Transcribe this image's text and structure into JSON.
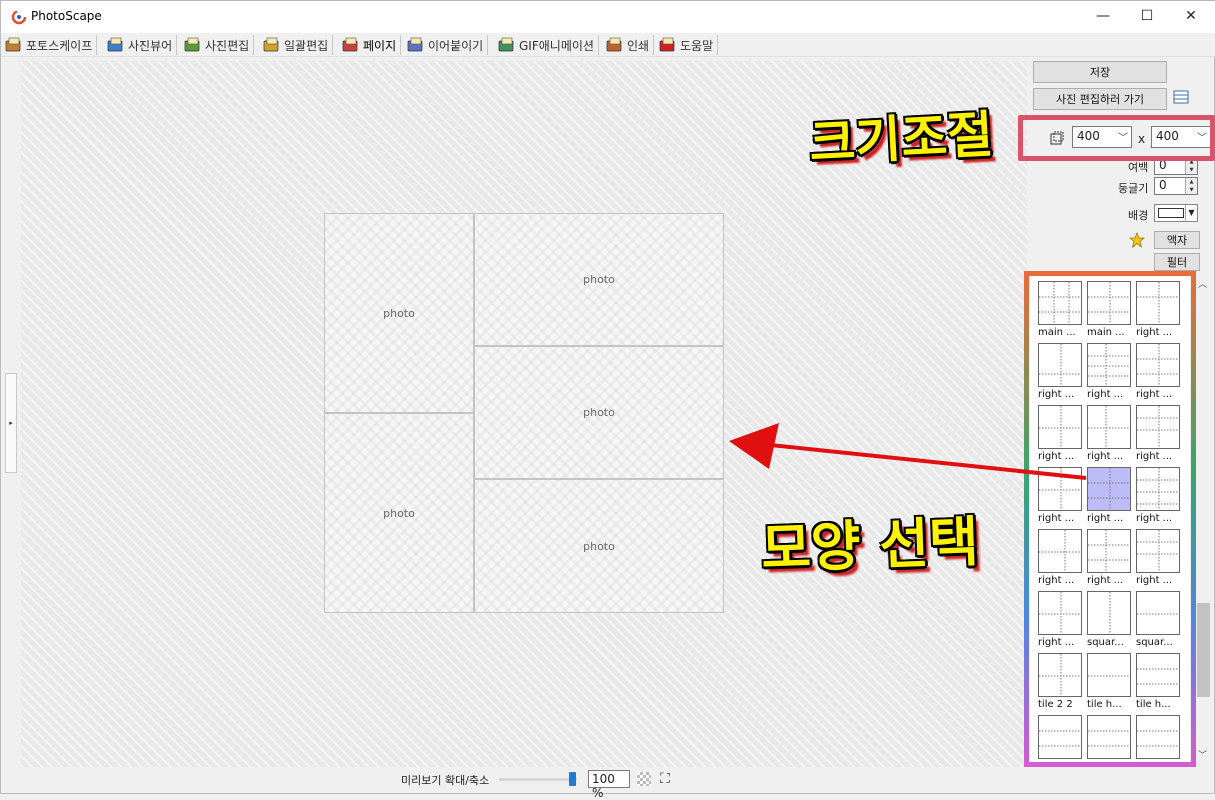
{
  "window": {
    "title": "PhotoScape",
    "controls": {
      "minimize": "—",
      "maximize": "☐",
      "close": "✕"
    }
  },
  "tabs": [
    {
      "label": "포토스케이프",
      "color": "#c08030"
    },
    {
      "label": "사진뷰어",
      "color": "#3b7fd0"
    },
    {
      "label": "사진편집",
      "color": "#5a9a3a"
    },
    {
      "label": "일괄편집",
      "color": "#d0a030"
    },
    {
      "label": "페이지",
      "color": "#c84040",
      "active": true
    },
    {
      "label": "이어붙이기",
      "color": "#6070c0"
    },
    {
      "label": "GIF애니메이션",
      "color": "#409060"
    },
    {
      "label": "인쇄",
      "color": "#c06030"
    },
    {
      "label": "도움말",
      "color": "#d02020"
    }
  ],
  "page_cells": [
    "photo",
    "photo",
    "photo",
    "photo",
    "photo"
  ],
  "bottom": {
    "zoom_label": "미리보기 확대/축소",
    "zoom_value": "100 %",
    "zoom_level_percent": 100
  },
  "panel": {
    "save": "저장",
    "go_edit": "사진 편집하러 가기",
    "width": "400",
    "times": "x",
    "height": "400",
    "margin_label": "여백",
    "margin_value": "0",
    "round_label": "둥글기",
    "round_value": "0",
    "bg_label": "배경",
    "bg_color": "#ffffff",
    "frame_button": "액자",
    "filter_button": "필터"
  },
  "templates": [
    "main ...",
    "main ...",
    "right ...",
    "right ...",
    "right ...",
    "right ...",
    "right ...",
    "right ...",
    "right ...",
    "right ...",
    "right ...",
    "right ...",
    "right ...",
    "right ...",
    "right ...",
    "right ...",
    "squar...",
    "squar...",
    "tile 2 2",
    "tile h...",
    "tile h..."
  ],
  "selected_template_index": 10,
  "annotations": {
    "size_label": "크기조절",
    "shape_label": "모양 선택"
  }
}
